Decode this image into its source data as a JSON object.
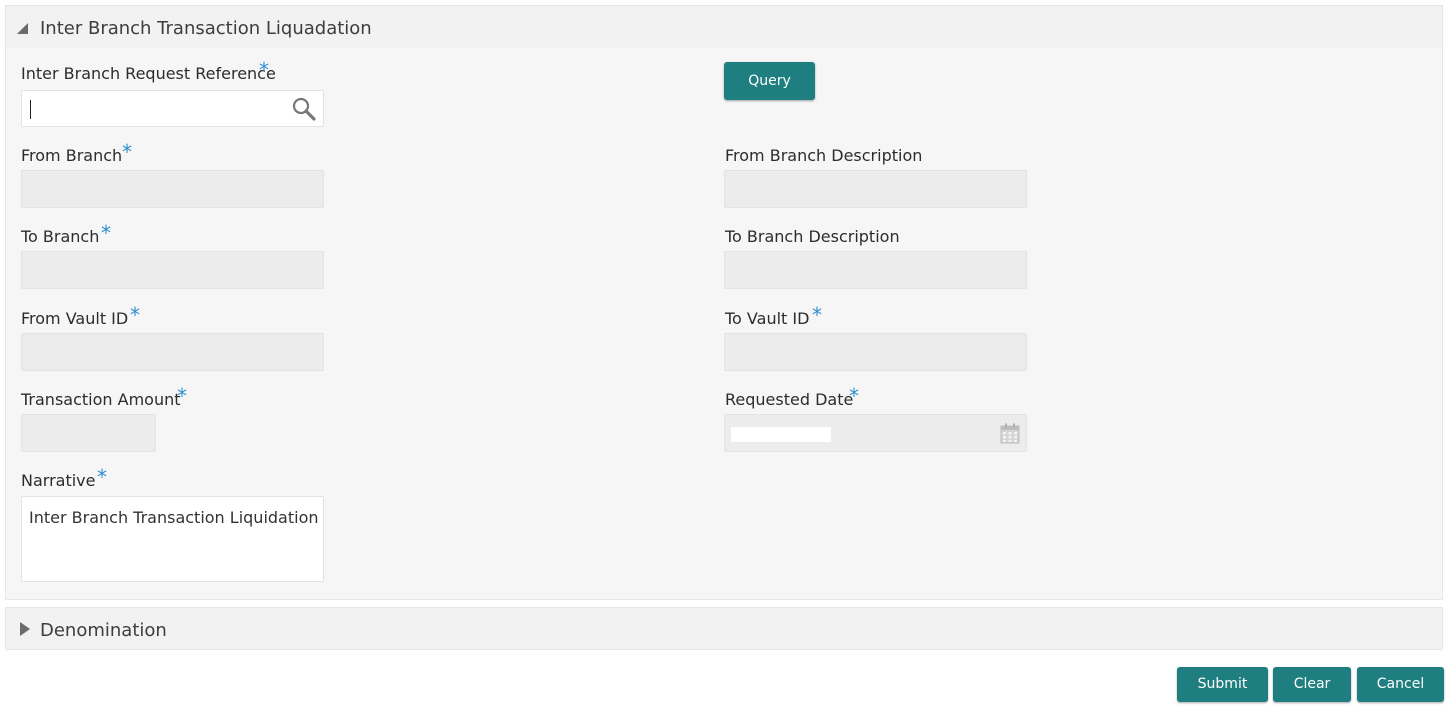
{
  "main_section": {
    "title": "Inter Branch Transaction Liquadation",
    "fields": {
      "request_reference": {
        "label": "Inter Branch Request Reference",
        "required_mark": "*",
        "value": ""
      },
      "from_branch": {
        "label": "From Branch",
        "required_mark": "*",
        "value": ""
      },
      "from_branch_description": {
        "label": "From Branch Description",
        "value": ""
      },
      "to_branch": {
        "label": "To Branch",
        "required_mark": "*",
        "value": ""
      },
      "to_branch_description": {
        "label": "To Branch Description",
        "value": ""
      },
      "from_vault_id": {
        "label": "From Vault ID",
        "required_mark": "*",
        "value": ""
      },
      "to_vault_id": {
        "label": "To Vault ID",
        "required_mark": "*",
        "value": ""
      },
      "transaction_amount": {
        "label": "Transaction Amount",
        "required_mark": "*",
        "value": ""
      },
      "requested_date": {
        "label": "Requested Date",
        "required_mark": "*"
      },
      "narrative": {
        "label": "Narrative",
        "required_mark": "*",
        "value": "Inter Branch Transaction Liquidation"
      }
    },
    "query_button": "Query"
  },
  "denomination_section": {
    "title": "Denomination"
  },
  "footer": {
    "submit": "Submit",
    "clear": "Clear",
    "cancel": "Cancel"
  },
  "colors": {
    "accent_teal": "#1f7f80",
    "required_mark": "#2f8fcf",
    "panel_bg": "#f6f6f6",
    "disabled_field": "#ececec"
  },
  "icons": {
    "search": "search-icon",
    "calendar": "calendar-icon",
    "collapse": "triangle-down-icon",
    "expand": "triangle-right-icon"
  }
}
